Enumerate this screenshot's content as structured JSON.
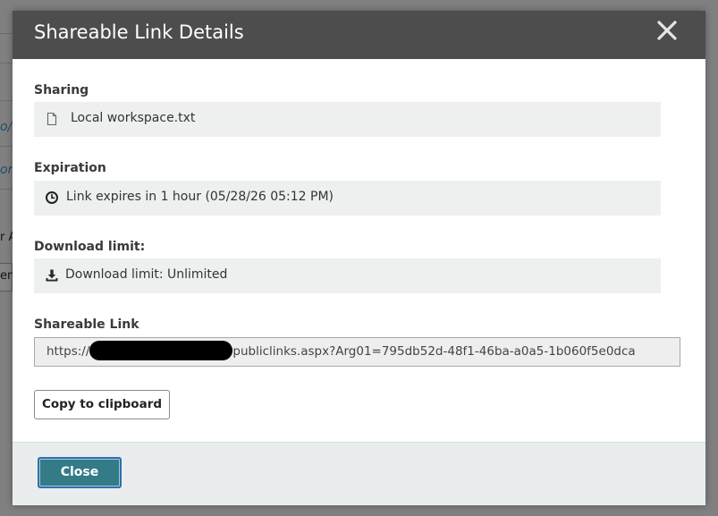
{
  "background": {
    "fragments": [
      {
        "text": "o/l",
        "style": "italic"
      },
      {
        "text": "ork",
        "style": "italic"
      },
      {
        "text": "r A",
        "style": "dark"
      },
      {
        "text": "en",
        "style": "dark"
      }
    ]
  },
  "dialog": {
    "title": "Shareable Link Details",
    "close_icon": "close-x-icon",
    "sharing": {
      "label": "Sharing",
      "icon": "document-icon",
      "value": "Local workspace.txt"
    },
    "expiration": {
      "label": "Expiration",
      "icon": "clock-icon",
      "value": "Link expires in 1 hour (05/28/26 05:12 PM)"
    },
    "download_limit": {
      "label": "Download limit:",
      "icon": "download-icon",
      "value": "Download limit: Unlimited"
    },
    "shareable_link": {
      "label": "Shareable Link",
      "value_prefix": "https://",
      "value_suffix": "publiclinks.aspx?Arg01=795db52d-48f1-46ba-a0a5-1b060f5e0dca"
    },
    "copy_button": "Copy to clipboard",
    "close_button": "Close"
  },
  "colors": {
    "header": "#4d4d4d",
    "field_background": "#eef0f0",
    "close_button": "#327b87",
    "close_button_border": "#2f6fb2",
    "footer": "#eaeded"
  }
}
